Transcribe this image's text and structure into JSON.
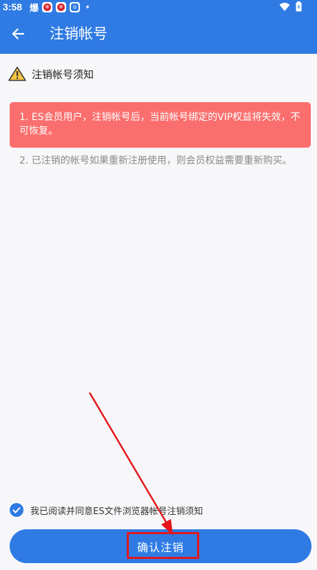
{
  "status_bar": {
    "time": "3:58",
    "fire_label": "爆"
  },
  "app_bar": {
    "title": "注销帐号"
  },
  "notice": {
    "title": "注销帐号须知",
    "item1": "1. ES会员用户，注销帐号后，当前帐号绑定的VIP权益将失效，不可恢复。",
    "item2": "2. 已注销的帐号如果重新注册使用，则会员权益需要重新购买。"
  },
  "agreement": {
    "text": "我已阅读并同意ES文件浏览器帐号注销须知",
    "checked": true
  },
  "confirm_button": {
    "label": "确认注销"
  },
  "colors": {
    "primary": "#2f7be3",
    "warning_bg": "#fa6f6e",
    "annotation": "#e3161c"
  }
}
